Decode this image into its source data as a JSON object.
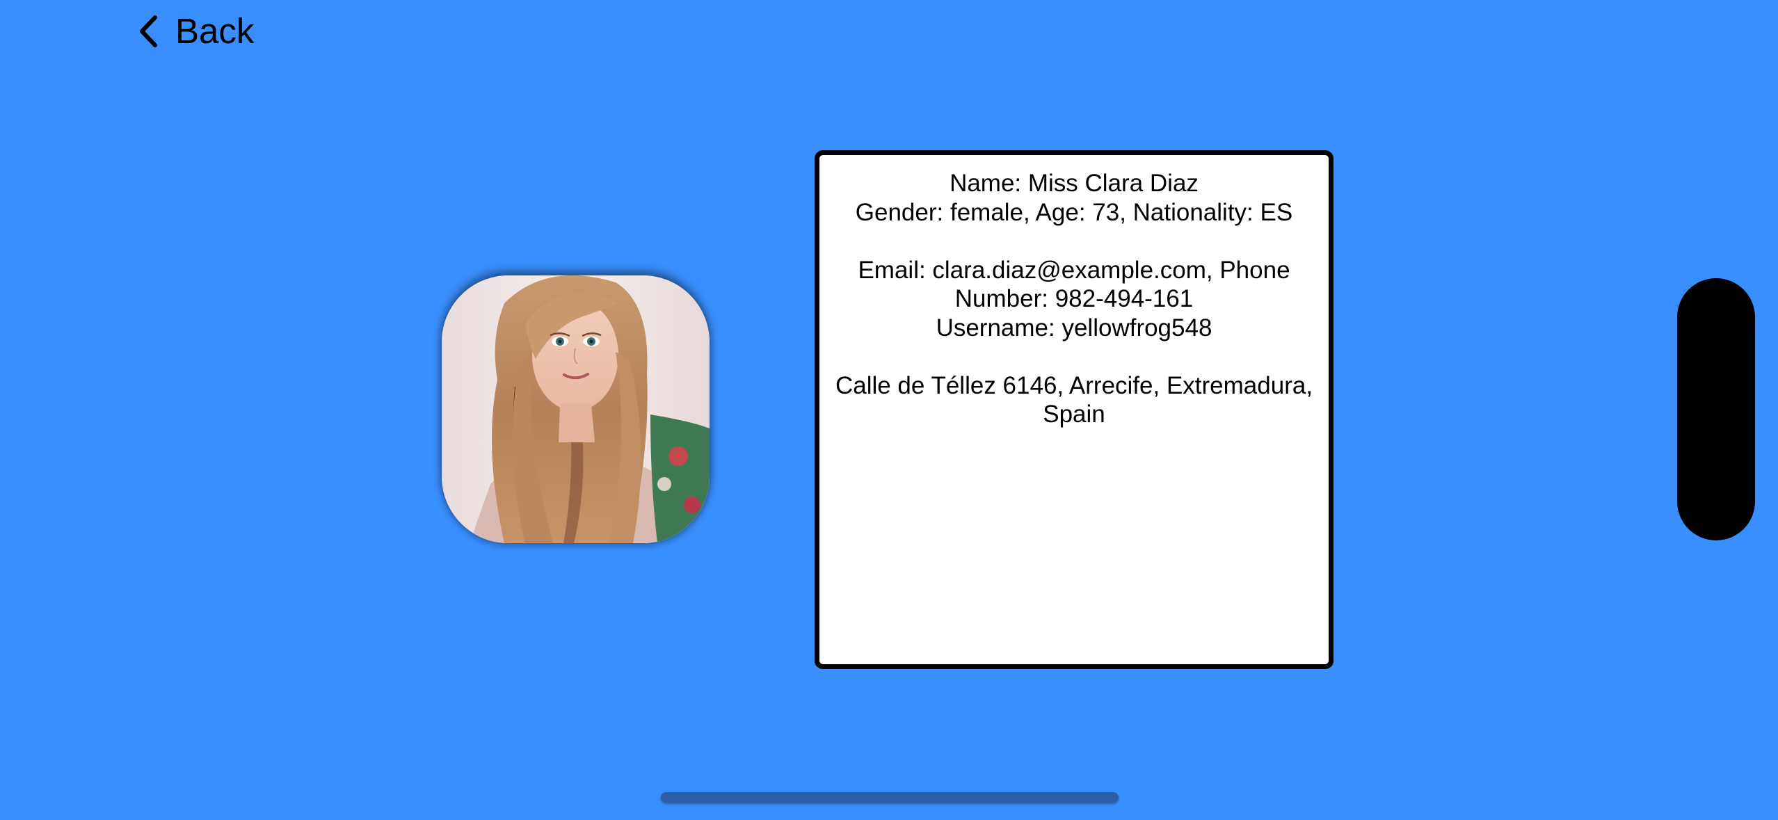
{
  "nav": {
    "back_label": "Back",
    "back_icon": "chevron-left-icon"
  },
  "profile": {
    "avatar_icon": "profile-photo",
    "name_line": "Name: Miss Clara Diaz",
    "details_line": "Gender: female, Age: 73, Nationality: ES",
    "contact_line_1": "Email: clara.diaz@example.com, Phone",
    "contact_line_2": "Number: 982-494-161",
    "username_line": "Username: yellowfrog548",
    "address_line_1": "Calle de Téllez 6146, Arrecife, Extremadura,",
    "address_line_2": "Spain"
  },
  "colors": {
    "background": "#3a8ffe",
    "card_background": "#ffffff",
    "card_border": "#000000",
    "side_pill": "#000000"
  }
}
